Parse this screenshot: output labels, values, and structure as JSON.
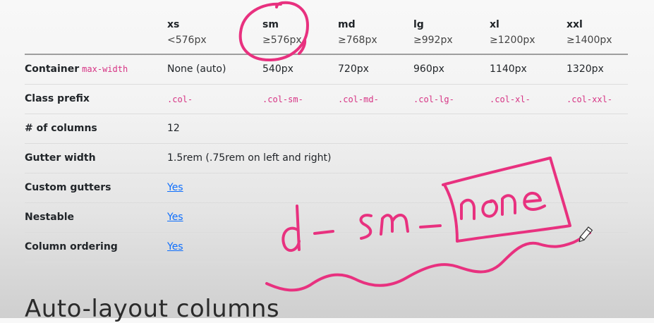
{
  "table": {
    "breakpoints": [
      {
        "name": "xs",
        "size": "<576px"
      },
      {
        "name": "sm",
        "size": "≥576px"
      },
      {
        "name": "md",
        "size": "≥768px"
      },
      {
        "name": "lg",
        "size": "≥992px"
      },
      {
        "name": "xl",
        "size": "≥1200px"
      },
      {
        "name": "xxl",
        "size": "≥1400px"
      }
    ],
    "container_row": {
      "label": "Container",
      "label_code": "max-width",
      "values": [
        "None (auto)",
        "540px",
        "720px",
        "960px",
        "1140px",
        "1320px"
      ]
    },
    "prefix_row": {
      "label": "Class prefix",
      "values": [
        ".col-",
        ".col-sm-",
        ".col-md-",
        ".col-lg-",
        ".col-xl-",
        ".col-xxl-"
      ]
    },
    "columns_row": {
      "label": "# of columns",
      "value": "12"
    },
    "gutter_row": {
      "label": "Gutter width",
      "value": "1.5rem (.75rem on left and right)"
    },
    "custom_gutters_row": {
      "label": "Custom gutters",
      "value": "Yes"
    },
    "nestable_row": {
      "label": "Nestable",
      "value": "Yes"
    },
    "ordering_row": {
      "label": "Column ordering",
      "value": "Yes"
    }
  },
  "section_heading": "Auto-layout columns",
  "annotation": {
    "handwritten_text": "d-sm-none",
    "ink_color": "#e8317f",
    "cursor_icon": "pen-cursor-icon"
  }
}
